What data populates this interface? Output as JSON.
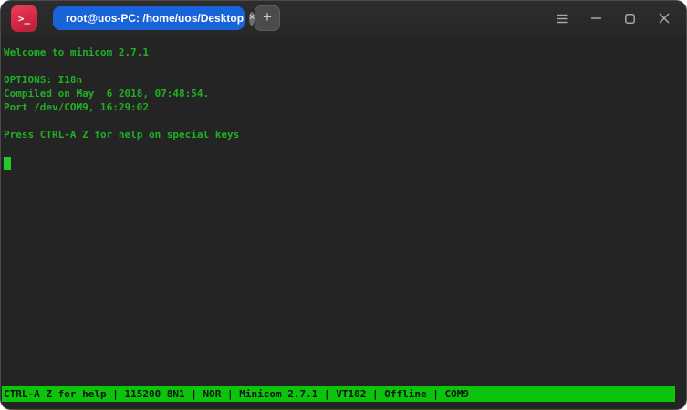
{
  "titlebar": {
    "app_icon_glyph": ">_",
    "tab": {
      "label": "root@uos-PC: /home/uos/Desktop",
      "close_glyph": "×"
    },
    "new_tab_glyph": "+"
  },
  "terminal": {
    "lines": [
      "Welcome to minicom 2.7.1",
      "",
      "OPTIONS: I18n",
      "Compiled on May  6 2018, 07:48:54.",
      "Port /dev/COM9, 16:29:02",
      "",
      "Press CTRL-A Z for help on special keys",
      ""
    ],
    "cursor_visible": "true"
  },
  "statusbar": {
    "text": "CTRL-A Z for help | 115200 8N1 | NOR | Minicom 2.7.1 | VT102 | Offline | COM9"
  },
  "colors": {
    "window_bg": "#242424",
    "titlebar_bg": "#2c2c2c",
    "tab_bg": "#1963d8",
    "app_icon_red": "#d32745",
    "terminal_text_green": "#1fb125",
    "cursor_green": "#27c82b",
    "statusbar_green": "#0bc40b",
    "statusbar_text": "#101010",
    "control_icon_grey": "#a8a8a8"
  }
}
